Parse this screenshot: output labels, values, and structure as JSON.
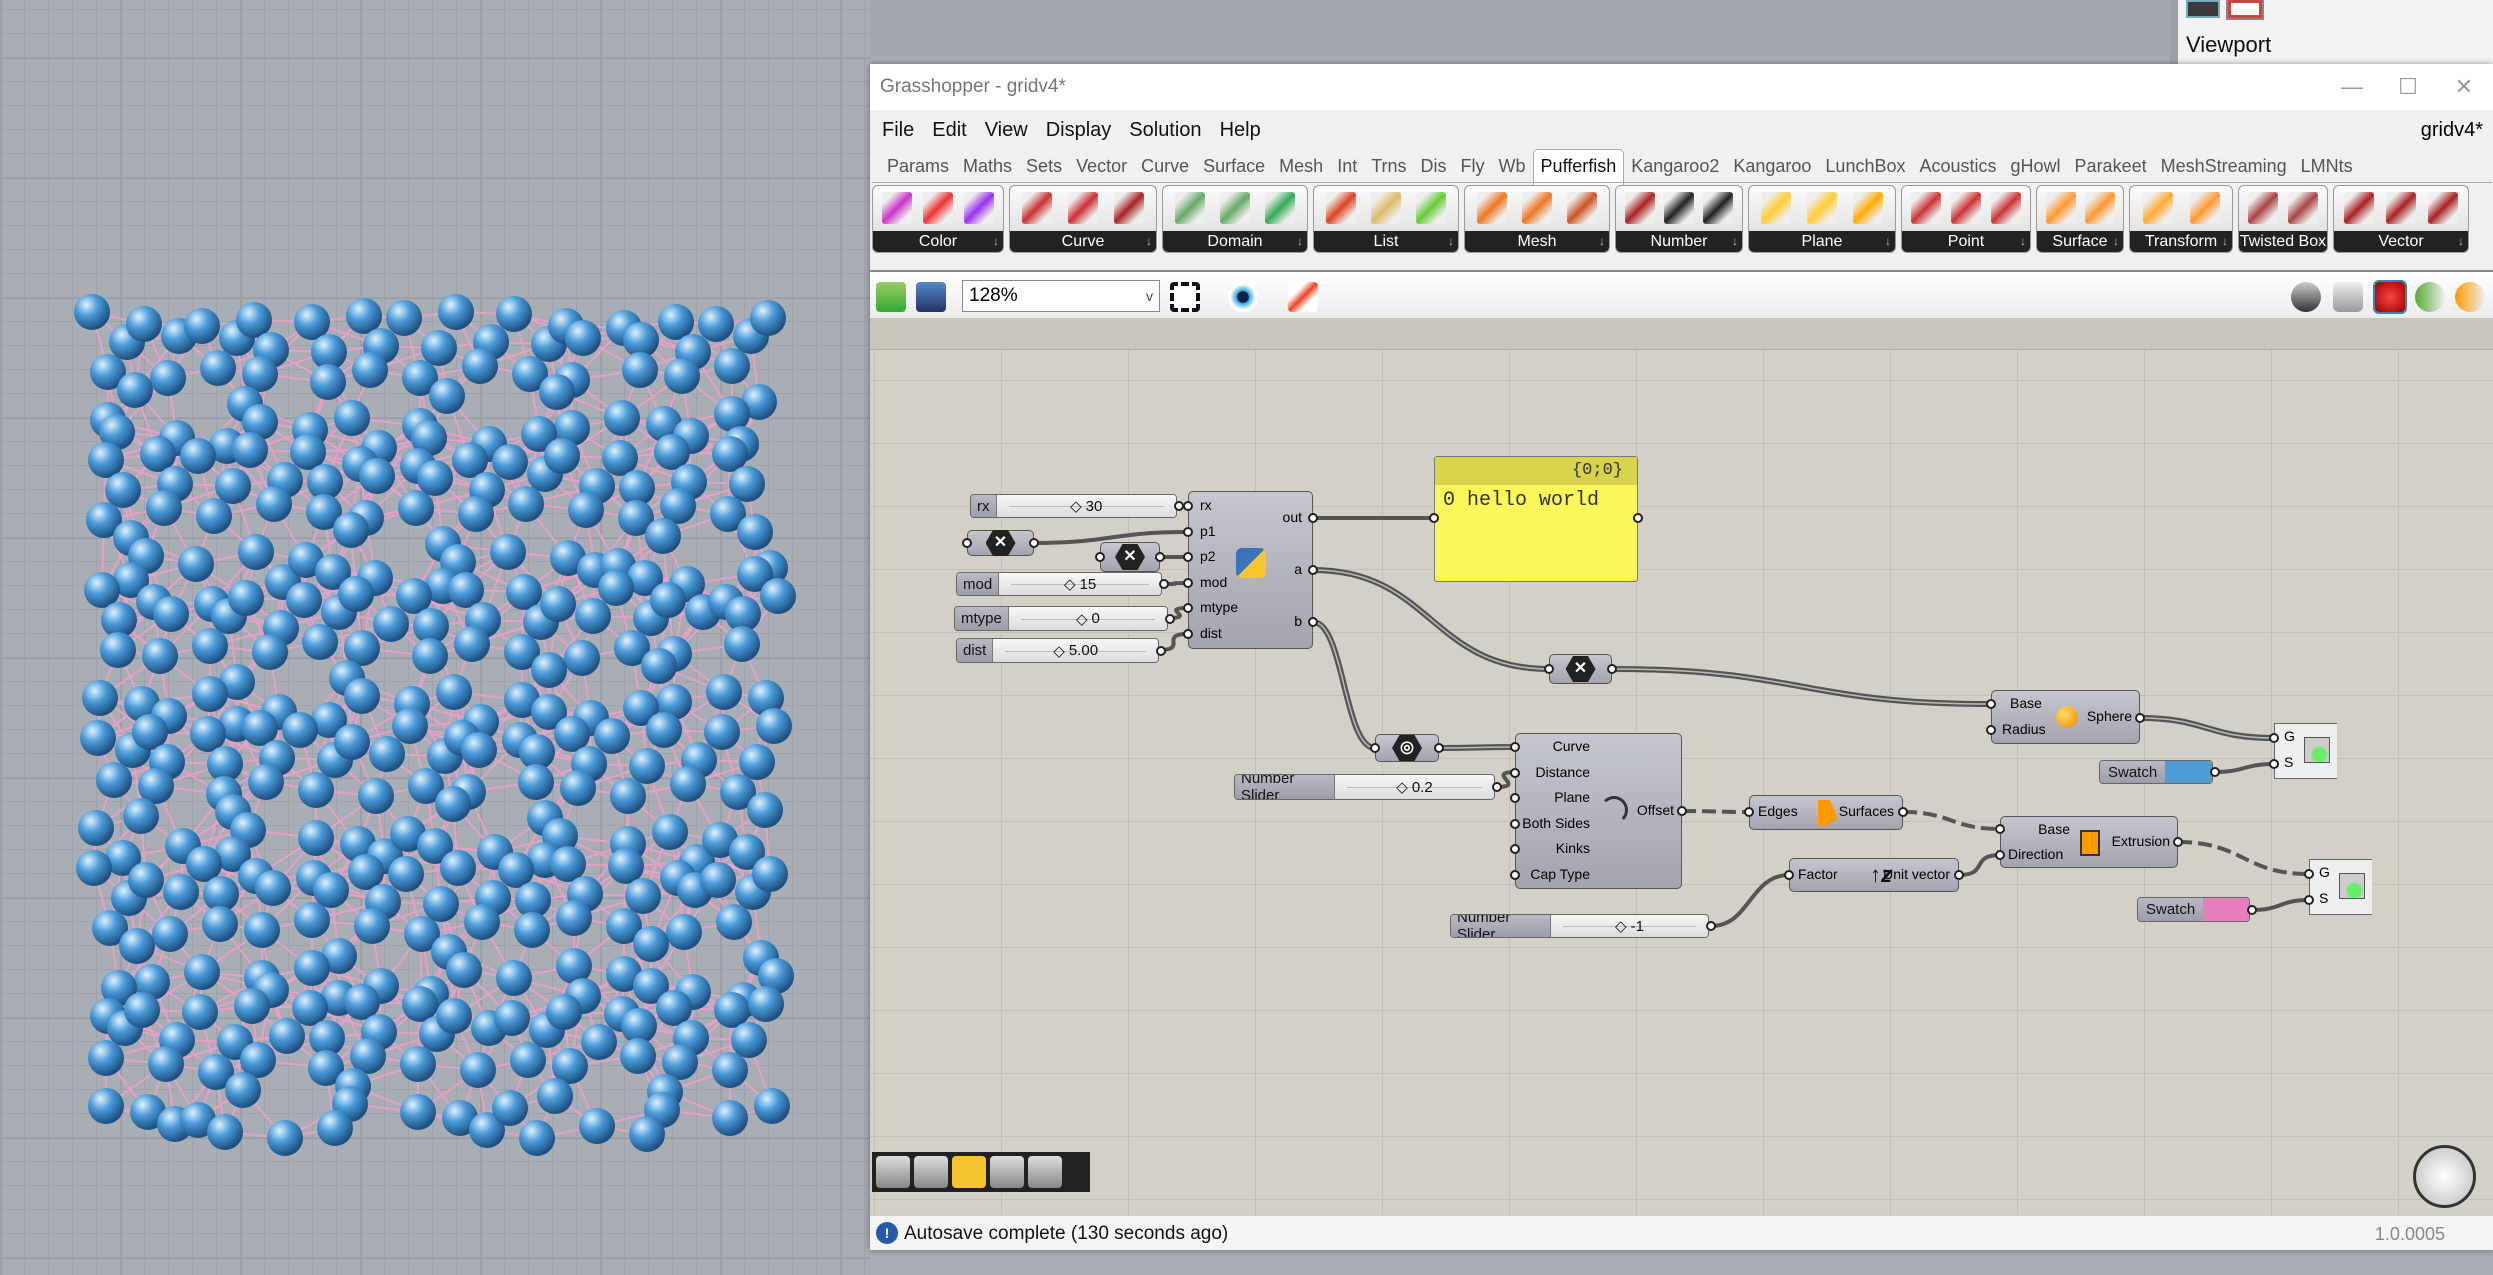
{
  "rhino": {
    "panel_title": "Viewport",
    "sphere_color": "#4a9ad8",
    "line_color": "#e8a0c8"
  },
  "window": {
    "title": "Grasshopper - gridv4*",
    "minimize": "—",
    "maximize": "☐",
    "close": "✕"
  },
  "menu": {
    "items": [
      "File",
      "Edit",
      "View",
      "Display",
      "Solution",
      "Help"
    ],
    "document_name": "gridv4*"
  },
  "tabs": {
    "items": [
      "Params",
      "Maths",
      "Sets",
      "Vector",
      "Curve",
      "Surface",
      "Mesh",
      "Int",
      "Trns",
      "Dis",
      "Fly",
      "Wb",
      "Pufferfish",
      "Kangaroo2",
      "Kangaroo",
      "LunchBox",
      "Acoustics",
      "gHowl",
      "Parakeet",
      "MeshStreaming",
      "LMNts"
    ],
    "active": "Pufferfish"
  },
  "ribbon": {
    "groups": [
      "Color",
      "Curve",
      "Domain",
      "List",
      "Mesh",
      "Number",
      "Plane",
      "Point",
      "Surface",
      "Transform",
      "Twisted Box",
      "Vector"
    ],
    "dropdown_glyph": "↓"
  },
  "toolbar": {
    "zoom": "128%",
    "zoom_caret": "v"
  },
  "canvas": {
    "sliders": {
      "rx": {
        "label": "rx",
        "value": "30"
      },
      "mod": {
        "label": "mod",
        "value": "15"
      },
      "mtype": {
        "label": "mtype",
        "value": "0"
      },
      "dist": {
        "label": "dist",
        "value": "5.00"
      },
      "distance": {
        "label": "Number Slider",
        "value": "0.2"
      },
      "factor": {
        "label": "Number Slider",
        "value": "-1"
      }
    },
    "python": {
      "inputs": [
        "rx",
        "p1",
        "p2",
        "mod",
        "mtype",
        "dist"
      ],
      "outputs": [
        "out",
        "a",
        "b"
      ]
    },
    "panel": {
      "path": "{0;0}",
      "content": "0 hello world"
    },
    "sphere": {
      "inputs": [
        "Base",
        "Radius"
      ],
      "output": "Sphere"
    },
    "offset": {
      "inputs": [
        "Curve",
        "Distance",
        "Plane",
        "Both Sides",
        "Kinks",
        "Cap Type"
      ],
      "output": "Offset"
    },
    "boundary": {
      "input": "Edges",
      "output": "Surfaces"
    },
    "extrusion": {
      "inputs": [
        "Base",
        "Direction"
      ],
      "output": "Extrusion"
    },
    "unit_vector": {
      "input": "Factor",
      "output": "Unit vector"
    },
    "preview": {
      "inputs": [
        "G",
        "S"
      ]
    },
    "swatch1": {
      "label": "Swatch",
      "color": "#4f9bd4"
    },
    "swatch2": {
      "label": "Swatch",
      "color": "#e87dbd"
    },
    "param_glyph": "✕"
  },
  "status": {
    "message": "Autosave complete (130 seconds ago)",
    "version": "1.0.0005"
  }
}
